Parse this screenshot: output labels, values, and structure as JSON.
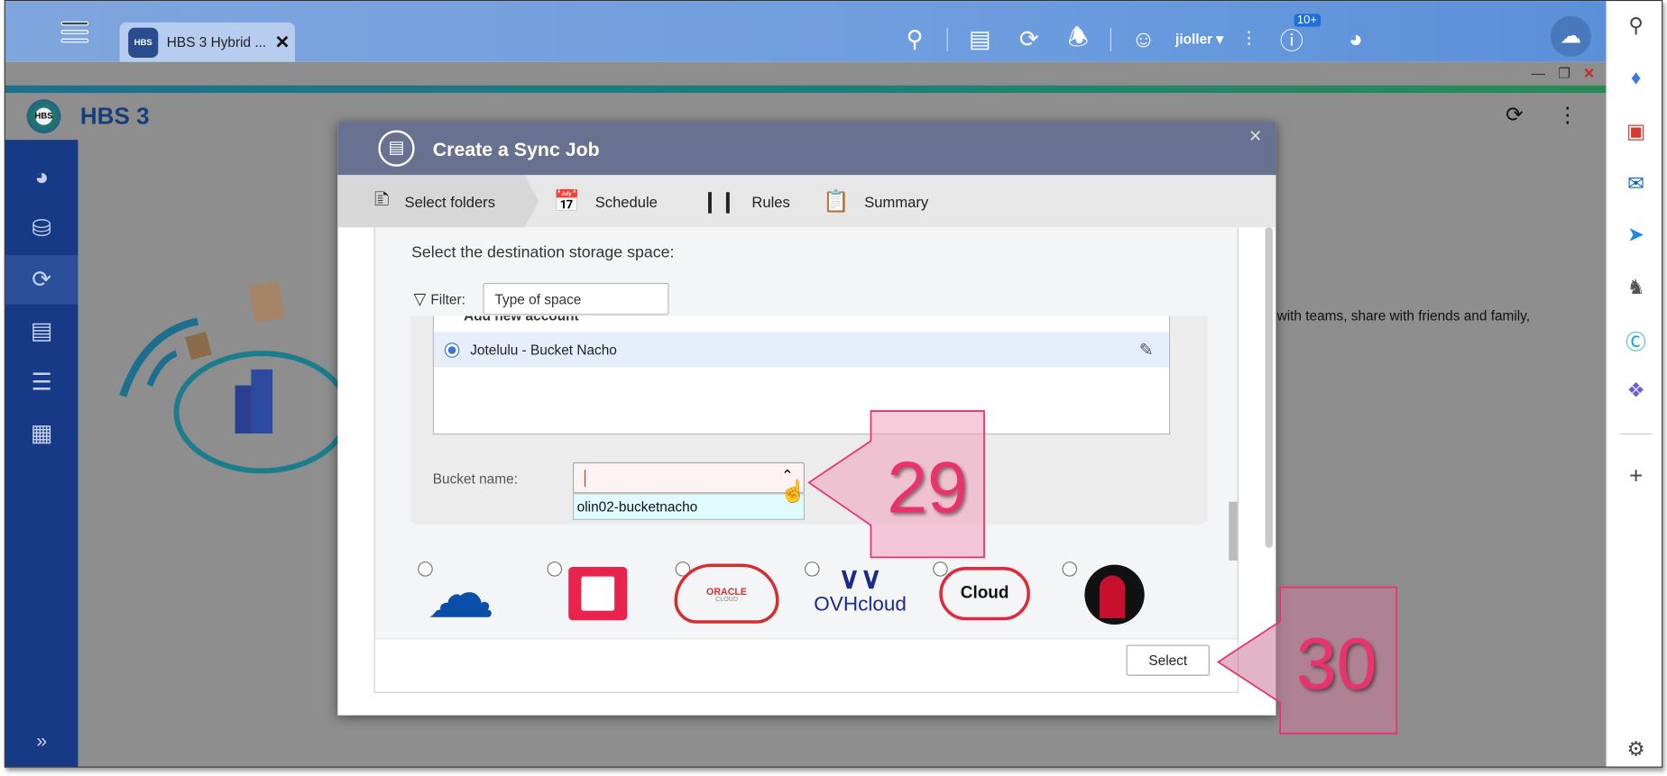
{
  "topbar": {
    "tab_label": "HBS 3 Hybrid ...",
    "tab_icon_text": "HBS",
    "username": "jioller ▾",
    "badge": "10+"
  },
  "app": {
    "title": "HBS 3",
    "logo_text": "HBS",
    "background_text": "with teams, share with friends and family,"
  },
  "dialog": {
    "title": "Create a Sync Job",
    "close": "×",
    "steps": [
      {
        "label": "Select folders",
        "active": true
      },
      {
        "label": "Schedule"
      },
      {
        "label": "Rules"
      },
      {
        "label": "Summary"
      }
    ],
    "prompt": "Select the destination storage space:",
    "filter_label": "Filter:",
    "filter_value": "Type of space",
    "hidden_row": "Add new account",
    "accounts": [
      {
        "label": "Jotelulu - Bucket Nacho",
        "selected": true
      }
    ],
    "bucket_label": "Bucket name:",
    "bucket_value": "",
    "bucket_options": [
      "olin02-bucketnacho"
    ],
    "providers": [
      {
        "name": "OneDrive",
        "icon": "onedrive-icon"
      },
      {
        "name": "OpenStack",
        "icon": "openstack-icon"
      },
      {
        "name": "ORACLE",
        "sub": "CLOUD",
        "icon": "oracle-cloud-icon"
      },
      {
        "name": "OVHcloud",
        "icon": "ovhcloud-icon"
      },
      {
        "name": "Cloud",
        "icon": "qcloud-icon"
      },
      {
        "name": "Rackspace",
        "icon": "rackspace-icon"
      }
    ],
    "select_button": "Select"
  },
  "annotations": {
    "step_a": "29",
    "step_b": "30",
    "color": "#e8336d"
  },
  "colors": {
    "topbar": "#6d9ddf",
    "nav": "#173a87",
    "dialog_header": "#687290",
    "highlight_row": "#e6eefc"
  }
}
